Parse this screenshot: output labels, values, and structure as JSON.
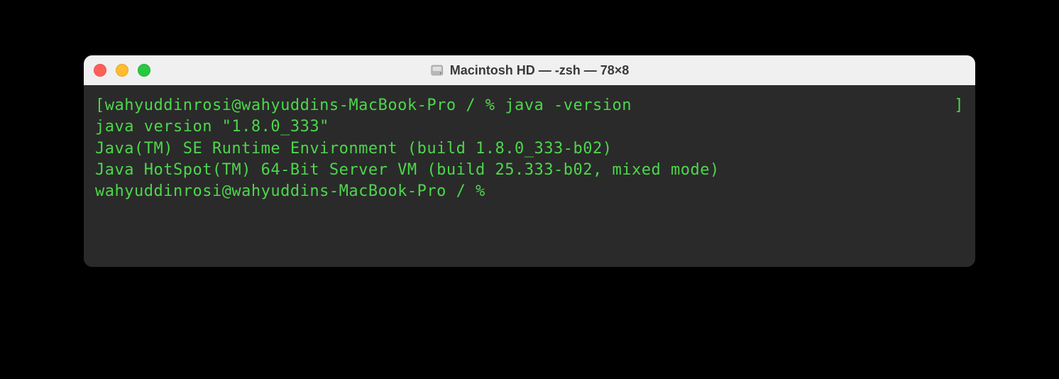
{
  "window": {
    "title": "Macintosh HD — -zsh — 78×8"
  },
  "terminal": {
    "line1_prompt": "wahyuddinrosi@wahyuddins-MacBook-Pro / % ",
    "line1_command": "java -version",
    "line1_open_bracket": "[",
    "line1_close_bracket": "]",
    "line2": "java version \"1.8.0_333\"",
    "line3": "Java(TM) SE Runtime Environment (build 1.8.0_333-b02)",
    "line4": "Java HotSpot(TM) 64-Bit Server VM (build 25.333-b02, mixed mode)",
    "line5": "wahyuddinrosi@wahyuddins-MacBook-Pro / % "
  }
}
